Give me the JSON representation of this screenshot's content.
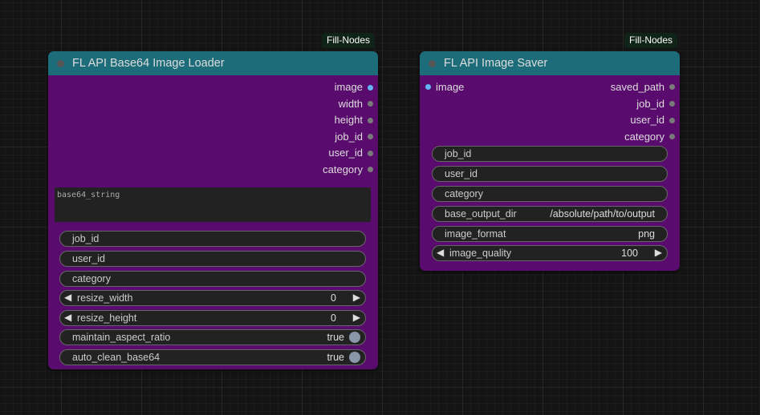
{
  "colors": {
    "node_body": "#5a0c6e",
    "node_title": "#1d6c7a",
    "badge_bg": "#0f2319",
    "image_port": "#64b5f6",
    "port": "#7a7a7a",
    "widget_bg": "#222222"
  },
  "loader": {
    "badge": "Fill-Nodes",
    "title": "FL API Base64 Image Loader",
    "outputs": [
      "image",
      "width",
      "height",
      "job_id",
      "user_id",
      "category"
    ],
    "textarea_placeholder": "base64_string",
    "widgets": {
      "job_id": "job_id",
      "user_id": "user_id",
      "category": "category",
      "resize_width": {
        "label": "resize_width",
        "value": "0"
      },
      "resize_height": {
        "label": "resize_height",
        "value": "0"
      },
      "maintain_aspect_ratio": {
        "label": "maintain_aspect_ratio",
        "value": "true"
      },
      "auto_clean_base64": {
        "label": "auto_clean_base64",
        "value": "true"
      }
    }
  },
  "saver": {
    "badge": "Fill-Nodes",
    "title": "FL API Image Saver",
    "input": "image",
    "outputs": [
      "saved_path",
      "job_id",
      "user_id",
      "category"
    ],
    "widgets": {
      "job_id": "job_id",
      "user_id": "user_id",
      "category": "category",
      "base_output_dir": {
        "label": "base_output_dir",
        "value": "/absolute/path/to/output"
      },
      "image_format": {
        "label": "image_format",
        "value": "png"
      },
      "image_quality": {
        "label": "image_quality",
        "value": "100"
      }
    }
  }
}
